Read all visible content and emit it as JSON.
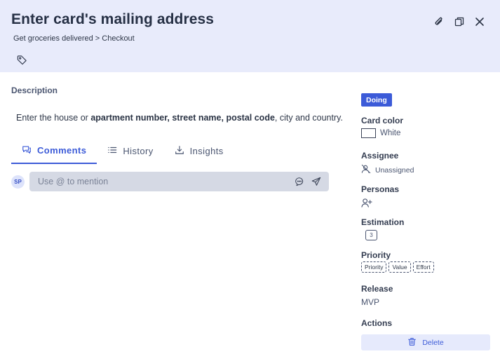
{
  "card": {
    "title": "Enter card's mailing address",
    "breadcrumb": "Get groceries delivered > Checkout"
  },
  "header_icons": [
    "paperclip-icon",
    "copy-icon",
    "close-icon",
    "tag-icon"
  ],
  "description": {
    "label": "Description",
    "parts": [
      {
        "text": "Enter the house or ",
        "bold": false
      },
      {
        "text": "apartment number, street name, postal code",
        "bold": true
      },
      {
        "text": ", city and country.",
        "bold": false
      }
    ]
  },
  "tabs": [
    {
      "label": "Comments",
      "icon": "comment-icon",
      "active": true
    },
    {
      "label": "History",
      "icon": "list-icon",
      "active": false
    },
    {
      "label": "Insights",
      "icon": "download-icon",
      "active": false
    }
  ],
  "comment": {
    "avatar": "SP",
    "placeholder": "Use @ to mention"
  },
  "sidebar": {
    "status": "Doing",
    "card_color_label": "Card color",
    "card_color_value": "White",
    "assignee_label": "Assignee",
    "assignee_value": "Unassigned",
    "personas_label": "Personas",
    "estimation_label": "Estimation",
    "estimation_value": "3",
    "priority_label": "Priority",
    "priority_chips": [
      "Priority",
      "Value",
      "Effort"
    ],
    "release_label": "Release",
    "release_value": "MVP",
    "actions_label": "Actions",
    "delete_label": "Delete"
  },
  "colors": {
    "accent": "#3c5bd8",
    "header_bg": "#e8ebfb",
    "comment_bg": "#d5d9e4"
  }
}
